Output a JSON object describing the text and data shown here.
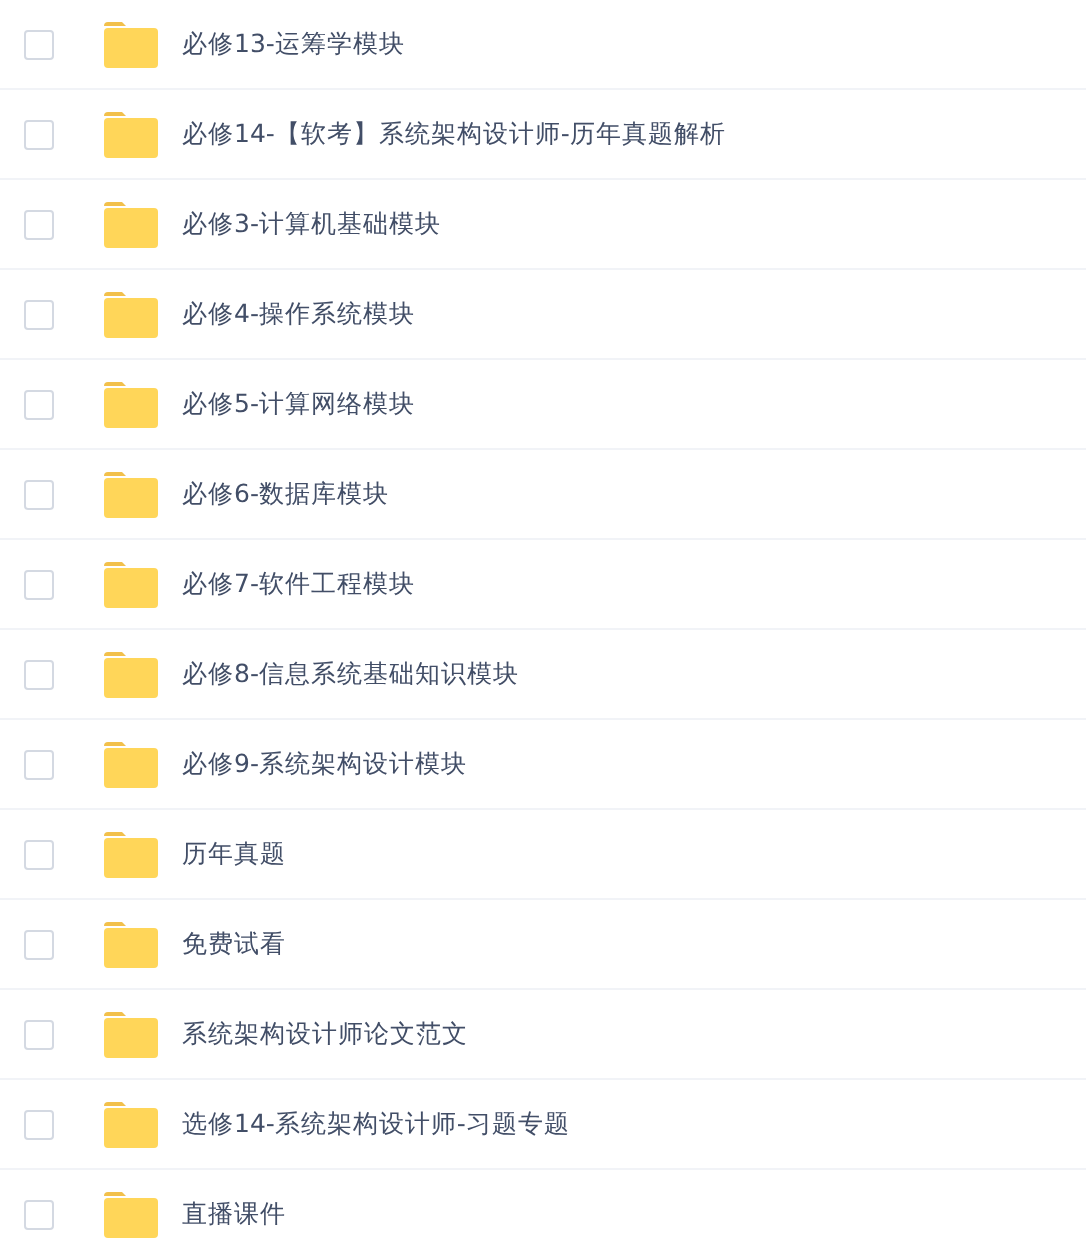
{
  "files": [
    {
      "name": "必修13-运筹学模块",
      "checked": false
    },
    {
      "name": "必修14-【软考】系统架构设计师-历年真题解析",
      "checked": false
    },
    {
      "name": "必修3-计算机基础模块",
      "checked": false
    },
    {
      "name": "必修4-操作系统模块",
      "checked": false
    },
    {
      "name": "必修5-计算网络模块",
      "checked": false
    },
    {
      "name": "必修6-数据库模块",
      "checked": false
    },
    {
      "name": "必修7-软件工程模块",
      "checked": false
    },
    {
      "name": "必修8-信息系统基础知识模块",
      "checked": false
    },
    {
      "name": "必修9-系统架构设计模块",
      "checked": false
    },
    {
      "name": "历年真题",
      "checked": false
    },
    {
      "name": "免费试看",
      "checked": false
    },
    {
      "name": "系统架构设计师论文范文",
      "checked": false
    },
    {
      "name": "选修14-系统架构设计师-习题专题",
      "checked": false
    },
    {
      "name": "直播课件",
      "checked": false
    }
  ]
}
